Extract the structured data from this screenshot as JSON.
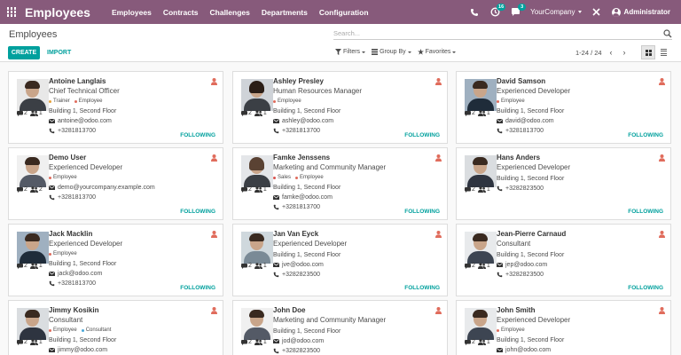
{
  "app": {
    "title": "Employees"
  },
  "menu": [
    "Employees",
    "Contracts",
    "Challenges",
    "Departments",
    "Configuration"
  ],
  "systray": {
    "activity_count": "16",
    "message_count": "3",
    "company": "YourCompany",
    "user": "Administrator"
  },
  "control": {
    "breadcrumb": "Employees",
    "search_placeholder": "Search...",
    "create_label": "CREATE",
    "import_label": "IMPORT",
    "filters_label": "Filters",
    "groupby_label": "Group By",
    "favorites_label": "Favorites",
    "pager": "1-24 / 24"
  },
  "colors": {
    "brand": "#875a7b",
    "accent": "#00a09d",
    "presence": "#e06c5c"
  },
  "tag_colors": {
    "Trainer": "#e6a23c",
    "Employee": "#e06c5c",
    "Sales": "#d9534f",
    "Consultant": "#4aa8d8"
  },
  "employees": [
    {
      "name": "Antoine Langlais",
      "job": "Chief Technical Officer",
      "tags": [
        "Trainer",
        "Employee"
      ],
      "location": "Building 1, Second Floor",
      "email": "antoine@odoo.com",
      "phone": "+3281813700",
      "msgs": "2",
      "followers": "1",
      "follow": "FOLLOWING"
    },
    {
      "name": "Ashley Presley",
      "job": "Human Resources Manager",
      "tags": [
        "Employee"
      ],
      "location": "Building 1, Second Floor",
      "email": "ashley@odoo.com",
      "phone": "+3281813700",
      "msgs": "2",
      "followers": "1",
      "follow": "FOLLOWING"
    },
    {
      "name": "David Samson",
      "job": "Experienced Developer",
      "tags": [
        "Employee"
      ],
      "location": "Building 1, Second Floor",
      "email": "david@odoo.com",
      "phone": "+3281813700",
      "msgs": "2",
      "followers": "1",
      "follow": "FOLLOWING"
    },
    {
      "name": "Demo User",
      "job": "Experienced Developer",
      "tags": [
        "Employee"
      ],
      "location": "",
      "email": "demo@yourcompany.example.com",
      "phone": "+3281813700",
      "msgs": "2",
      "followers": "2",
      "follow": "FOLLOWING"
    },
    {
      "name": "Famke Jenssens",
      "job": "Marketing and Community Manager",
      "tags": [
        "Sales",
        "Employee"
      ],
      "location": "Building 1, Second Floor",
      "email": "famke@odoo.com",
      "phone": "+3281813700",
      "msgs": "2",
      "followers": "1",
      "follow": "FOLLOWING"
    },
    {
      "name": "Hans Anders",
      "job": "Experienced Developer",
      "tags": [],
      "location": "Building 1, Second Floor",
      "email": "",
      "phone": "+3282823500",
      "msgs": "2",
      "followers": "1",
      "follow": "FOLLOWING"
    },
    {
      "name": "Jack Macklin",
      "job": "Experienced Developer",
      "tags": [
        "Employee"
      ],
      "location": "Building 1, Second Floor",
      "email": "jack@odoo.com",
      "phone": "+3281813700",
      "msgs": "2",
      "followers": "1",
      "follow": "FOLLOWING"
    },
    {
      "name": "Jan Van Eyck",
      "job": "Experienced Developer",
      "tags": [],
      "location": "Building 1, Second Floor",
      "email": "jve@odoo.com",
      "phone": "+3282823500",
      "msgs": "2",
      "followers": "1",
      "follow": "FOLLOWING"
    },
    {
      "name": "Jean-Pierre Carnaud",
      "job": "Consultant",
      "tags": [],
      "location": "Building 1, Second Floor",
      "email": "jep@odoo.com",
      "phone": "+3282823500",
      "msgs": "2",
      "followers": "1",
      "follow": "FOLLOWING"
    },
    {
      "name": "Jimmy Kosikin",
      "job": "Consultant",
      "tags": [
        "Employee",
        "Consultant"
      ],
      "location": "Building 1, Second Floor",
      "email": "jimmy@odoo.com",
      "phone": "",
      "msgs": "2",
      "followers": "1",
      "follow": ""
    },
    {
      "name": "John Doe",
      "job": "Marketing and Community Manager",
      "tags": [],
      "location": "Building 1, Second Floor",
      "email": "jod@odoo.com",
      "phone": "+3282823500",
      "msgs": "2",
      "followers": "1",
      "follow": ""
    },
    {
      "name": "John Smith",
      "job": "Experienced Developer",
      "tags": [
        "Employee"
      ],
      "location": "Building 1, Second Floor",
      "email": "john@odoo.com",
      "phone": "",
      "msgs": "2",
      "followers": "1",
      "follow": ""
    }
  ]
}
